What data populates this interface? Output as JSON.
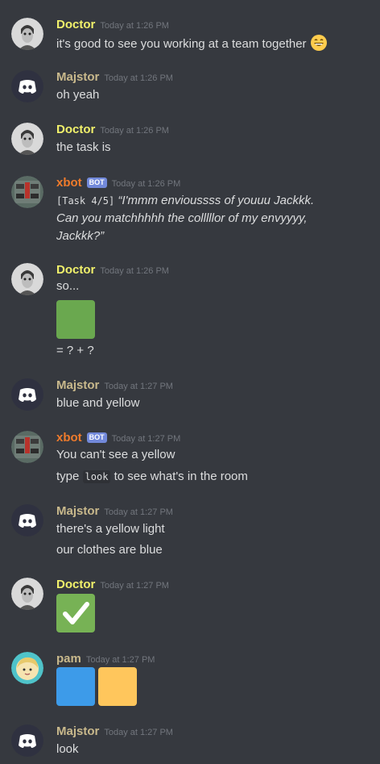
{
  "colors": {
    "background": "#36393f",
    "doctor": "#f1f16b",
    "majstor": "#c9b98c",
    "xbot": "#f07b2c",
    "pam": "#c9b98c",
    "bot_tag": "#7289da",
    "green_square": "#6aa84f",
    "blue_square": "#3d9be9",
    "orange_square": "#ffc65c"
  },
  "messages": [
    {
      "author": "Doctor",
      "time": "Today at 1:26 PM",
      "lines": [
        "it's good to see you working at a team together"
      ],
      "emoji": "grinning-face-icon"
    },
    {
      "author": "Majstor",
      "time": "Today at 1:26 PM",
      "lines": [
        "oh yeah"
      ]
    },
    {
      "author": "Doctor",
      "time": "Today at 1:26 PM",
      "lines": [
        "the task is"
      ]
    },
    {
      "author": "xbot",
      "bot_tag": "BOT",
      "time": "Today at 1:26 PM",
      "code": "[Task 4/5]",
      "lines": [
        "“I'mmm envioussss of youuu Jackkk.",
        "Can you matchhhhh the colllllor of my envyyyy,",
        "Jackkk?”"
      ]
    },
    {
      "author": "Doctor",
      "time": "Today at 1:26 PM",
      "lines": [
        "so...",
        "= ? + ?"
      ],
      "emoji": "green-square-icon"
    },
    {
      "author": "Majstor",
      "time": "Today at 1:27 PM",
      "lines": [
        "blue and yellow"
      ]
    },
    {
      "author": "xbot",
      "bot_tag": "BOT",
      "time": "Today at 1:27 PM",
      "lines": [
        "You can't see a yellow",
        "type",
        "to see what's in the room"
      ],
      "code": "look"
    },
    {
      "author": "Majstor",
      "time": "Today at 1:27 PM",
      "lines": [
        "there's a yellow light",
        "our clothes are blue"
      ]
    },
    {
      "author": "Doctor",
      "time": "Today at 1:27 PM",
      "emoji": "white-check-mark-icon"
    },
    {
      "author": "pam",
      "time": "Today at 1:27 PM",
      "emoji": [
        "blue-square-icon",
        "orange-square-icon"
      ]
    },
    {
      "author": "Majstor",
      "time": "Today at 1:27 PM",
      "lines": [
        "look"
      ]
    }
  ]
}
